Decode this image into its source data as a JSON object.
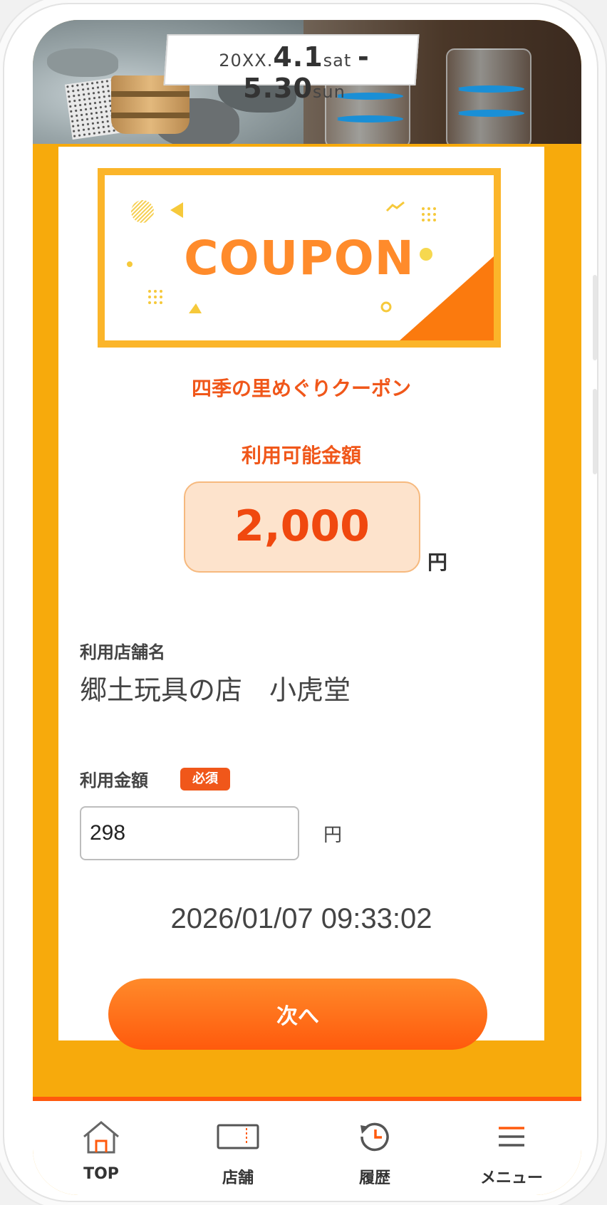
{
  "banner": {
    "period_prefix": "20XX.",
    "start_day": "4.1",
    "start_dow": "sat",
    "separator": "-",
    "end_day": "5.30",
    "end_dow": "sun"
  },
  "coupon": {
    "title": "COUPON",
    "name": "四季の里めぐりクーポン",
    "amount_label": "利用可能金額",
    "amount_value": "2,000",
    "amount_unit": "円"
  },
  "form": {
    "store_label": "利用店舗名",
    "store_name": "郷土玩具の店　小虎堂",
    "use_amount_label": "利用金額",
    "required_badge": "必須",
    "use_amount_value": "298",
    "use_amount_unit": "円",
    "timestamp": "2026/01/07 09:33:02",
    "next_button": "次へ"
  },
  "nav": {
    "items": [
      {
        "label": "TOP",
        "icon": "home-icon"
      },
      {
        "label": "店舗",
        "icon": "store-icon"
      },
      {
        "label": "履歴",
        "icon": "history-icon"
      },
      {
        "label": "メニュー",
        "icon": "menu-icon"
      }
    ]
  },
  "colors": {
    "frame": "#f7aa0c",
    "accent": "#f0571a",
    "button": "#ff6a18"
  }
}
